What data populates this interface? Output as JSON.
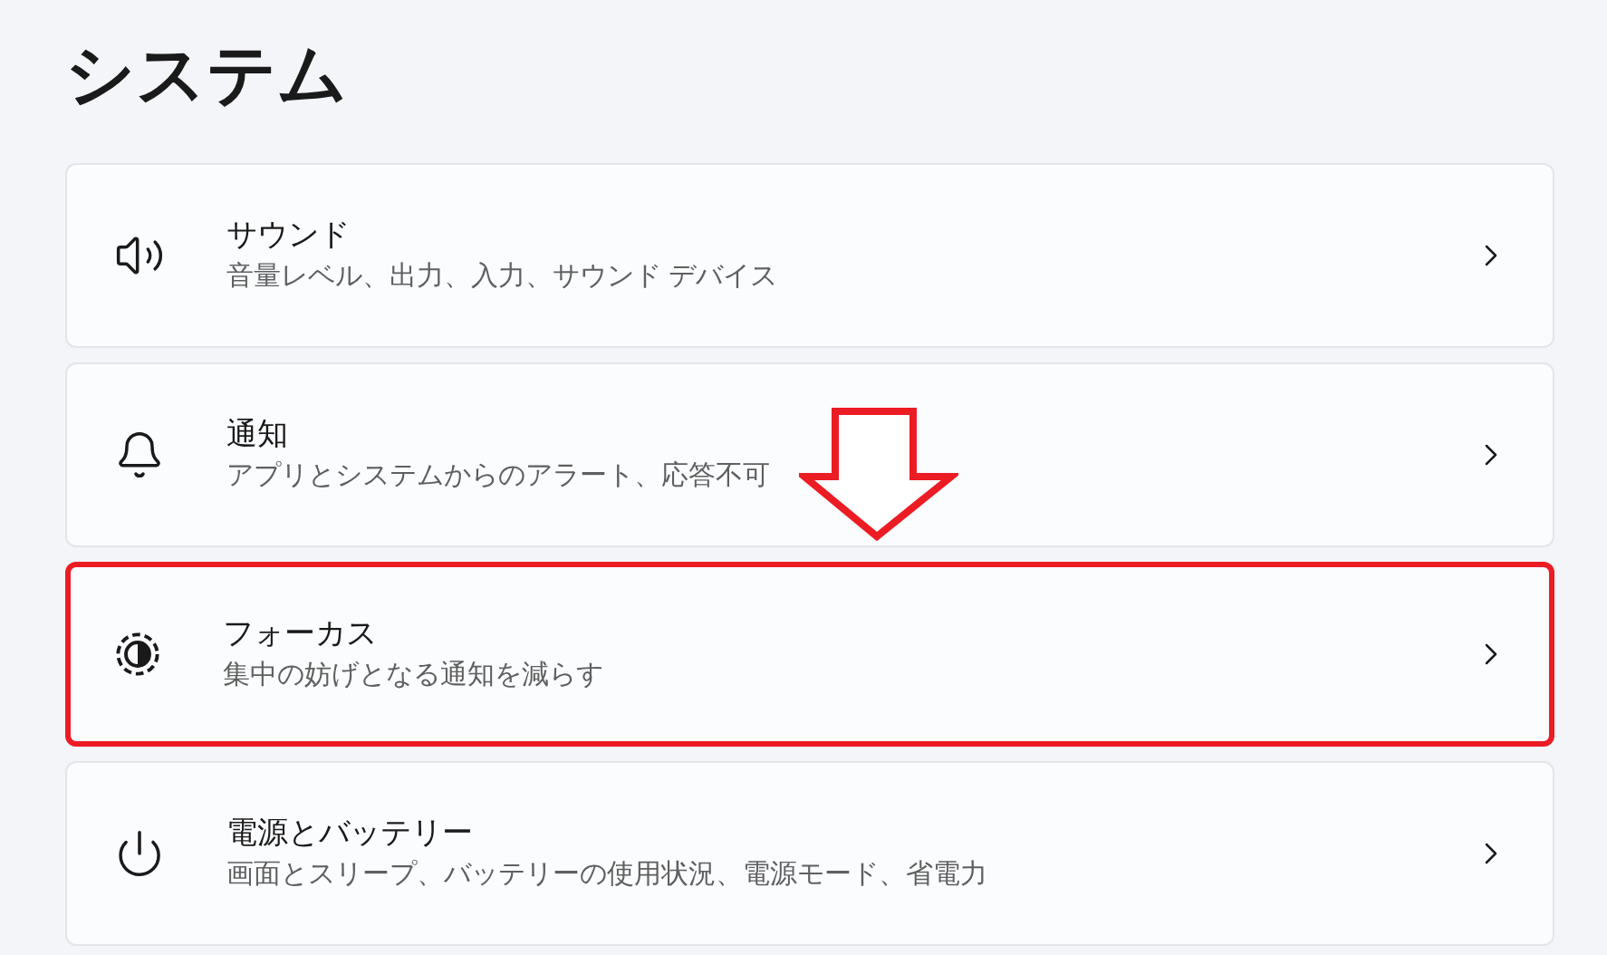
{
  "page_title": "システム",
  "items": [
    {
      "kind": "sound",
      "title": "サウンド",
      "description": "音量レベル、出力、入力、サウンド デバイス",
      "highlighted": false,
      "arrow_above": false
    },
    {
      "kind": "notifications",
      "title": "通知",
      "description": "アプリとシステムからのアラート、応答不可",
      "highlighted": false,
      "arrow_above": true
    },
    {
      "kind": "focus",
      "title": "フォーカス",
      "description": "集中の妨げとなる通知を減らす",
      "highlighted": true,
      "arrow_above": false
    },
    {
      "kind": "power",
      "title": "電源とバッテリー",
      "description": "画面とスリープ、バッテリーの使用状況、電源モード、省電力",
      "highlighted": false,
      "arrow_above": false
    }
  ]
}
